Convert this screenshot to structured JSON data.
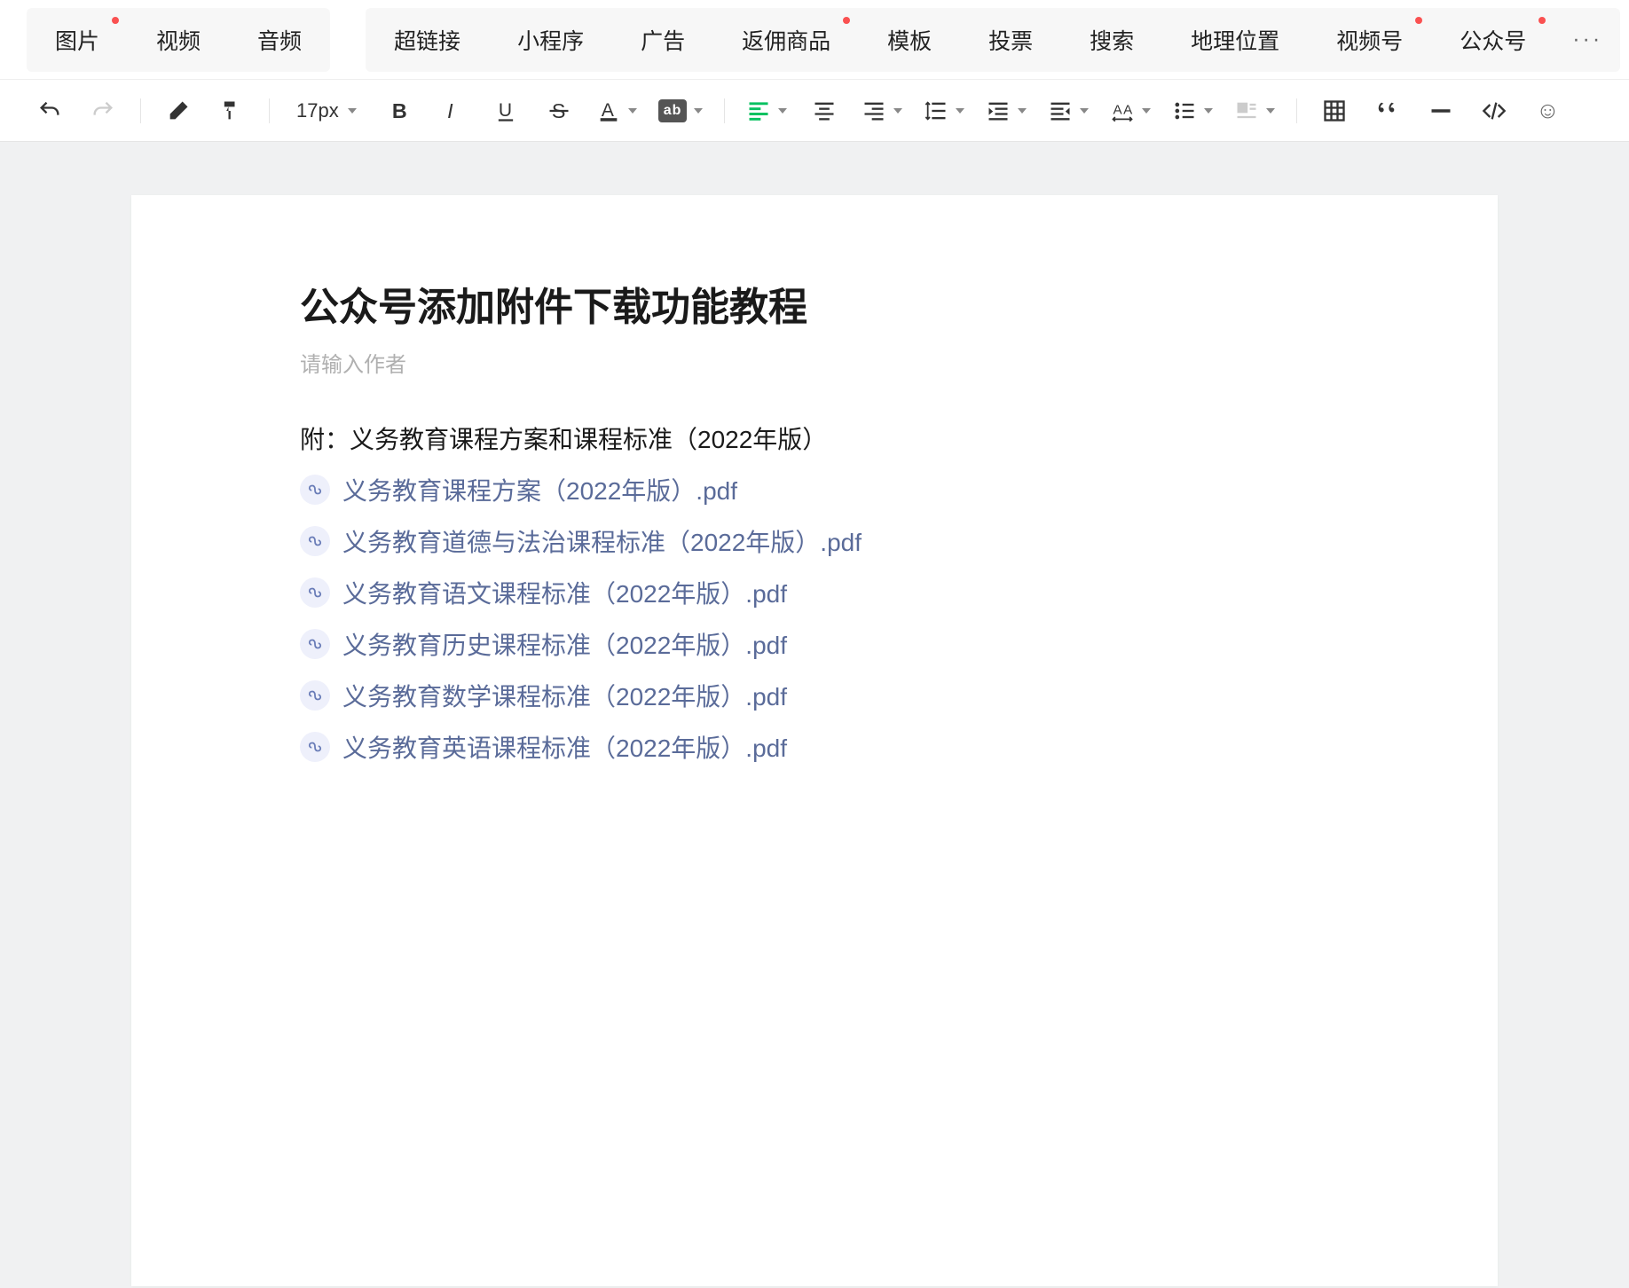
{
  "tabs": {
    "left": [
      {
        "label": "图片",
        "dot": true
      },
      {
        "label": "视频",
        "dot": false
      },
      {
        "label": "音频",
        "dot": false
      }
    ],
    "right": [
      {
        "label": "超链接",
        "dot": false
      },
      {
        "label": "小程序",
        "dot": false
      },
      {
        "label": "广告",
        "dot": false
      },
      {
        "label": "返佣商品",
        "dot": true
      },
      {
        "label": "模板",
        "dot": false
      },
      {
        "label": "投票",
        "dot": false
      },
      {
        "label": "搜索",
        "dot": false
      },
      {
        "label": "地理位置",
        "dot": false
      },
      {
        "label": "视频号",
        "dot": true
      },
      {
        "label": "公众号",
        "dot": true
      }
    ],
    "more": "···"
  },
  "toolbar": {
    "font_size": "17px",
    "ab_label": "ab"
  },
  "document": {
    "title": "公众号添加附件下载功能教程",
    "author_placeholder": "请输入作者",
    "attach_heading": "附：义务教育课程方案和课程标准（2022年版）",
    "attachments": [
      "义务教育课程方案（2022年版）.pdf",
      "义务教育道德与法治课程标准（2022年版）.pdf",
      "义务教育语文课程标准（2022年版）.pdf",
      "义务教育历史课程标准（2022年版）.pdf",
      "义务教育数学课程标准（2022年版）.pdf",
      "义务教育英语课程标准（2022年版）.pdf"
    ]
  }
}
